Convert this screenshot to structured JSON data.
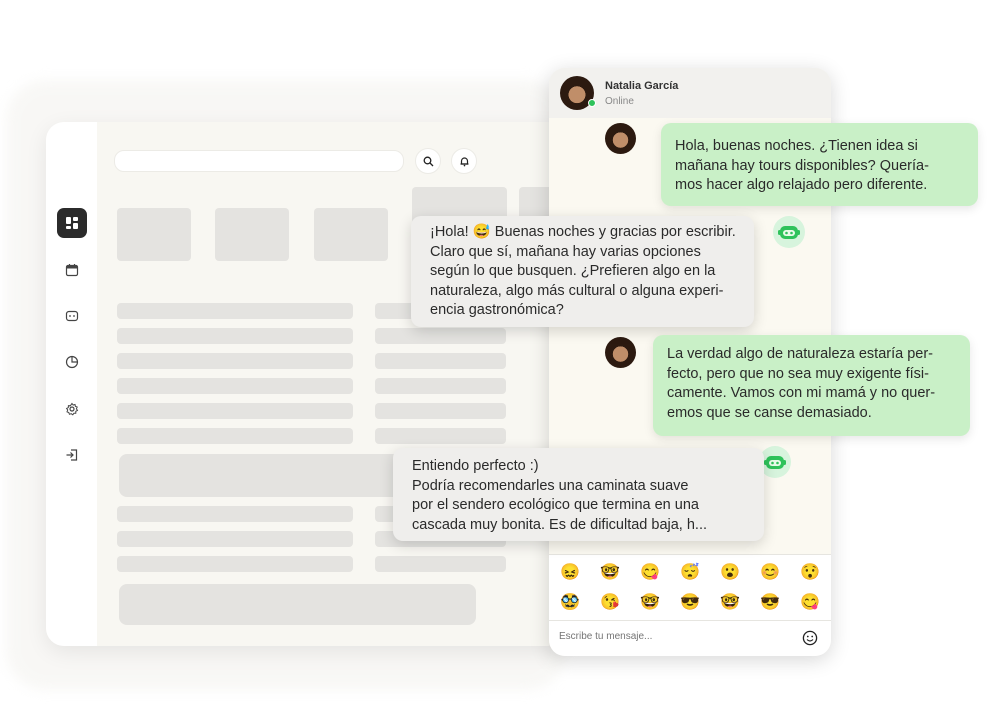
{
  "colors": {
    "user_bubble": "#c9f0c7",
    "bot_bubble": "#efeeec",
    "bot_accent": "#2fc25b",
    "sidebar_active": "#2b2b2b"
  },
  "sidebar": {
    "items": [
      {
        "icon": "dashboard-icon",
        "active": true
      },
      {
        "icon": "calendar-icon",
        "active": false
      },
      {
        "icon": "bot-icon",
        "active": false
      },
      {
        "icon": "pie-chart-icon",
        "active": false
      },
      {
        "icon": "gear-icon",
        "active": false
      },
      {
        "icon": "logout-icon",
        "active": false
      }
    ]
  },
  "header": {
    "search_placeholder": "",
    "icons": [
      "search-icon",
      "bell-icon"
    ]
  },
  "chat": {
    "contact": {
      "name": "Natalia García",
      "status": "Online"
    },
    "messages": [
      {
        "from": "user",
        "text": "Hola, buenas noches. ¿Tienen idea si\nmañana hay tours disponibles? Quería-\nmos hacer algo relajado pero diferente."
      },
      {
        "from": "bot",
        "text": "¡Hola! 😅 Buenas noches y gracias por escribir.\nClaro que sí, mañana hay varias opciones\nsegún lo que busquen. ¿Prefieren algo en la\nnaturaleza, algo más cultural o alguna experi-\nencia gastronómica?"
      },
      {
        "from": "user",
        "text": "La verdad algo de naturaleza estaría per-\nfecto, pero que no sea muy exigente físi-\ncamente. Vamos con mi mamá y no quer-\nemos que se canse demasiado."
      },
      {
        "from": "bot",
        "text": "Entiendo perfecto :)\nPodría recomendarles una caminata suave\npor el sendero ecológico que termina en una\ncascada muy bonita. Es de dificultad baja, h..."
      }
    ],
    "emojis": [
      "😖",
      "🤓",
      "😋",
      "😴",
      "😮",
      "😊",
      "😯",
      "🥸",
      "😘",
      "🤓",
      "😎",
      "🤓",
      "😎",
      "😋"
    ],
    "input_placeholder": "Escribe tu mensaje...",
    "emoji_button_icon": "smiley-icon"
  }
}
